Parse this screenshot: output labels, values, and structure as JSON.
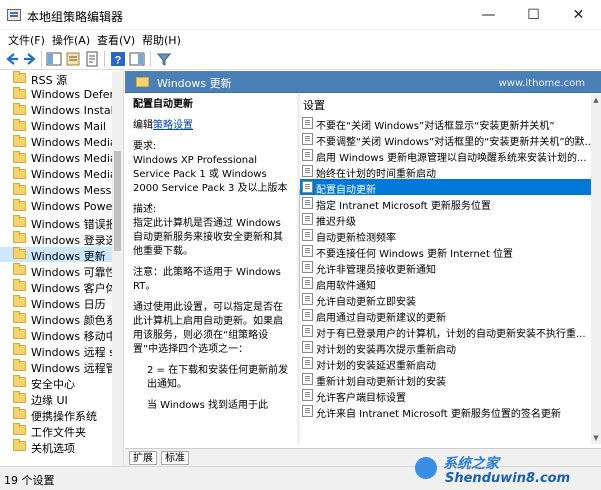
{
  "window": {
    "title": "本地组策略编辑器",
    "controls": {
      "minimize": "—",
      "maximize": "☐",
      "close": "✕"
    }
  },
  "menu": [
    "文件(F)",
    "操作(A)",
    "查看(V)",
    "帮助(H)"
  ],
  "toolbar": [
    "back-icon",
    "forward-icon",
    "show-hide-tree-icon",
    "properties-icon",
    "export-icon",
    "help-icon",
    "view-icon",
    "filter-icon"
  ],
  "tree": {
    "items": [
      "RSS 源",
      "Windows Defend",
      "Windows Installe",
      "Windows Mail",
      "Windows Media",
      "Windows Media",
      "Windows Media",
      "Windows Messer",
      "Windows PowerS",
      "Windows 错误报告",
      "Windows 登录选项",
      "Windows 更新",
      "Windows 可靠性分",
      "Windows 客户体验",
      "Windows 日历",
      "Windows 颜色系统",
      "Windows 移动中心",
      "Windows 远程 sh",
      "Windows 远程管理",
      "安全中心",
      "边缘 UI",
      "便携操作系统",
      "工作文件夹",
      "关机选项"
    ],
    "selected_index": 11
  },
  "right_header": {
    "title": "Windows 更新",
    "watermark": "www.ithome.com"
  },
  "description": {
    "title": "配置自动更新",
    "edit_prefix": "编辑",
    "edit_link": "策略设置",
    "req_label": "要求:",
    "req_text": "Windows XP Professional Service Pack 1 或 Windows 2000 Service Pack 3 及以上版本",
    "desc_label": "描述:",
    "desc_text": "指定此计算机是否通过 Windows 自动更新服务来接收安全更新和其他重要下载。",
    "note": "注意：此策略不适用于 Windows RT。",
    "para2": "通过使用此设置，可以指定是否在此计算机上启用自动更新。如果启用该服务，则必须在“组策略设置”中选择四个选项之一：",
    "para3": "2 = 在下载和安装任何更新前发出通知。",
    "para4": "当 Windows 找到适用于此"
  },
  "list": {
    "column": "设置",
    "rows": [
      "不要在“关闭 Windows”对话框显示“安装更新并关机”",
      "不要调整“关闭 Windows”对话框里的“安装更新并关机”的默...",
      "启用 Windows 更新电源管理以自动唤醒系统来安装计划的...",
      "始终在计划的时间重新启动",
      "配置自动更新",
      "指定 Intranet Microsoft 更新服务位置",
      "推迟升级",
      "自动更新检测频率",
      "不要连接任何 Windows 更新 Internet 位置",
      "允许非管理员接收更新通知",
      "启用软件通知",
      "允许自动更新立即安装",
      "启用通过自动更新建议的更新",
      "对于有已登录用户的计算机，计划的自动更新安装不执行重...",
      "对计划的安装再次提示重新启动",
      "对计划的安装延迟重新启动",
      "重新计划自动更新计划的安装",
      "允许客户端目标设置",
      "允许来自 Intranet Microsoft 更新服务位置的签名更新"
    ],
    "selected_index": 4
  },
  "tabs": [
    "扩展",
    "标准"
  ],
  "status": "19 个设置",
  "watermark": {
    "cn": "系统之家",
    "en": "Shenduwin8.com"
  },
  "colors": {
    "accent": "#0078d7",
    "header": "#4a7fb8",
    "selection_tree": "#cce8ff"
  }
}
